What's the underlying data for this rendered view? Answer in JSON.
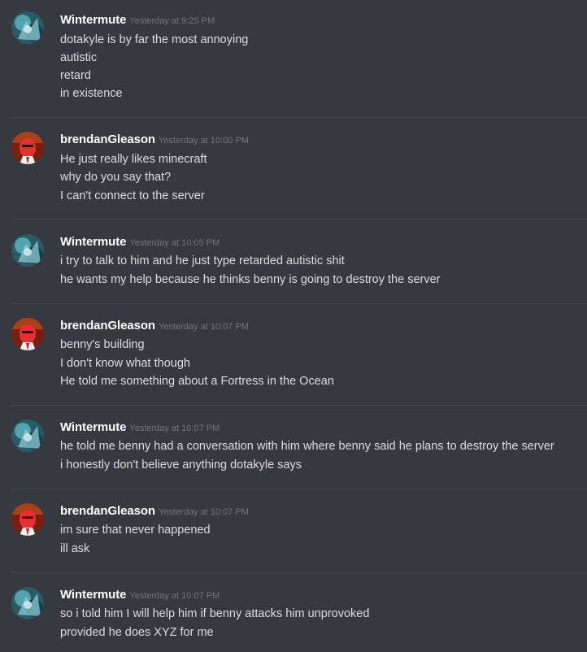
{
  "messages": [
    {
      "author": "Wintermute",
      "avatar": "wintermute-avatar",
      "timestamp": "Yesterday at 9:25 PM",
      "lines": [
        "dotakyle is by far the most annoying",
        "autistic",
        "retard",
        "in existence"
      ]
    },
    {
      "author": "brendanGleason",
      "avatar": "brendan-avatar",
      "timestamp": "Yesterday at 10:00 PM",
      "lines": [
        "He just really likes minecraft",
        "why do you say that?",
        "I can't connect to the server"
      ]
    },
    {
      "author": "Wintermute",
      "avatar": "wintermute-avatar",
      "timestamp": "Yesterday at 10:05 PM",
      "lines": [
        "i try to talk to him and he just type retarded autistic shit",
        "he wants my help because he thinks benny is going to destroy the server"
      ]
    },
    {
      "author": "brendanGleason",
      "avatar": "brendan-avatar",
      "timestamp": "Yesterday at 10:07 PM",
      "lines": [
        "benny's building",
        "I don't know what though",
        "He told me something about a Fortress in the Ocean"
      ]
    },
    {
      "author": "Wintermute",
      "avatar": "wintermute-avatar",
      "timestamp": "Yesterday at 10:07 PM",
      "lines": [
        "he told me benny had a conversation with him where benny said he plans to destroy the server",
        "i honestly don't believe anything dotakyle says"
      ]
    },
    {
      "author": "brendanGleason",
      "avatar": "brendan-avatar",
      "timestamp": "Yesterday at 10:07 PM",
      "lines": [
        "im sure that never happened",
        "ill ask"
      ]
    },
    {
      "author": "Wintermute",
      "avatar": "wintermute-avatar",
      "timestamp": "Yesterday at 10:07 PM",
      "lines": [
        "so i told him I will help him if benny attacks him unprovoked",
        "provided he does XYZ for me"
      ]
    }
  ],
  "colors": {
    "background": "#36393f",
    "divider": "#42454a",
    "username": "#ffffff",
    "timestamp": "#72767d",
    "message_text": "#dcddde"
  }
}
